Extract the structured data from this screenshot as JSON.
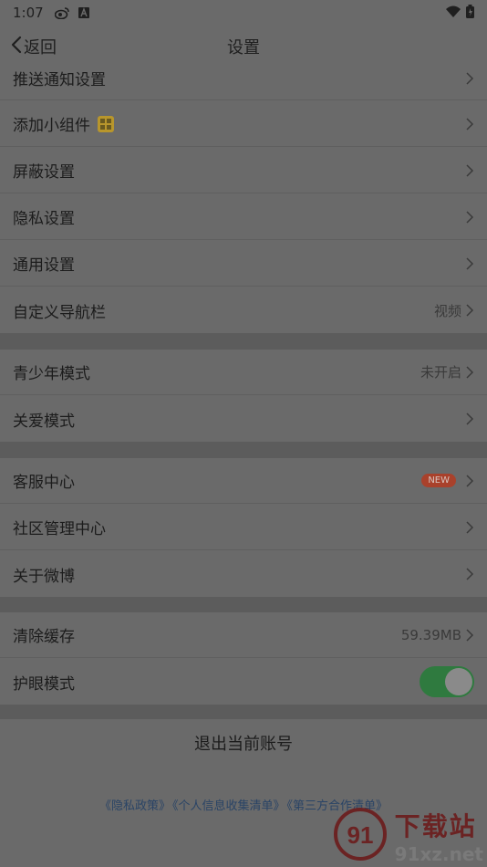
{
  "status_bar": {
    "time": "1:07",
    "icons_left": [
      "weibo-icon",
      "a-icon"
    ],
    "icons_right": [
      "wifi-icon",
      "battery-icon"
    ]
  },
  "nav": {
    "back_label": "返回",
    "title": "设置"
  },
  "sections": [
    {
      "items": [
        {
          "label": "推送通知设置",
          "value": ""
        },
        {
          "label": "添加小组件",
          "value": "",
          "icon": "widget-icon"
        },
        {
          "label": "屏蔽设置",
          "value": ""
        },
        {
          "label": "隐私设置",
          "value": ""
        },
        {
          "label": "通用设置",
          "value": ""
        },
        {
          "label": "自定义导航栏",
          "value": "视频"
        }
      ]
    },
    {
      "items": [
        {
          "label": "青少年模式",
          "value": "未开启"
        },
        {
          "label": "关爱模式",
          "value": ""
        }
      ]
    },
    {
      "items": [
        {
          "label": "客服中心",
          "value": "",
          "badge": "NEW"
        },
        {
          "label": "社区管理中心",
          "value": ""
        },
        {
          "label": "关于微博",
          "value": ""
        }
      ]
    },
    {
      "items": [
        {
          "label": "清除缓存",
          "value": "59.39MB"
        },
        {
          "label": "护眼模式",
          "toggle": true
        }
      ]
    }
  ],
  "logout_label": "退出当前账号",
  "footer_links": [
    "《隐私政策》",
    "《个人信息收集清单》",
    "《第三方合作清单》"
  ],
  "watermark": {
    "top": "下载站",
    "bottom": "91xz.net",
    "logo_text": "91"
  },
  "colors": {
    "toggle_on": "#2f7a3f",
    "badge": "#a9412b",
    "widget_icon": "#b8962c",
    "link": "#2a4466"
  }
}
